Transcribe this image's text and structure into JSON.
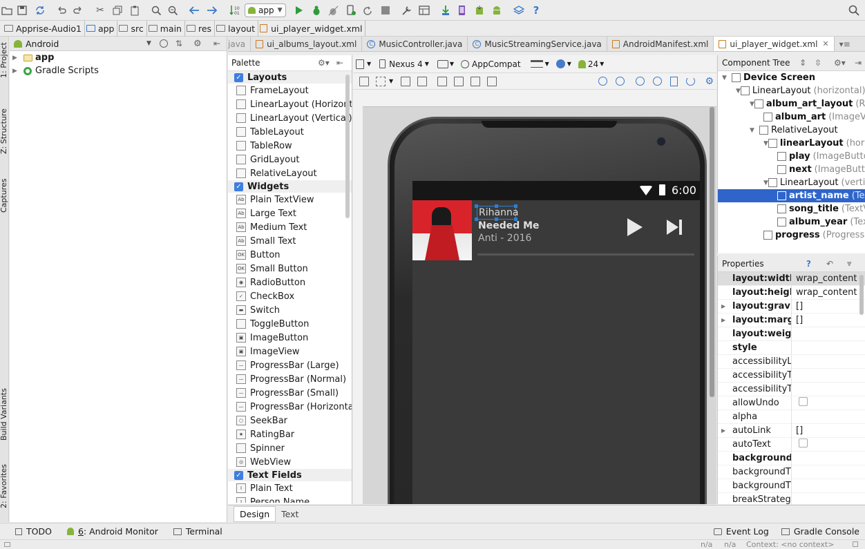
{
  "toolbar": {
    "run_config": "app",
    "icons": [
      "folder-open-icon",
      "save-icon",
      "sync-icon",
      "undo-icon",
      "redo-icon",
      "cut-icon",
      "copy-icon",
      "paste-icon",
      "find-icon",
      "replace-icon",
      "back-icon",
      "forward-icon",
      "build-icon",
      "run-config-icon",
      "run-icon",
      "debug-icon",
      "attach-debugger-icon",
      "apply-changes-icon",
      "rerun-icon",
      "stop-icon",
      "project-structure-icon",
      "sdk-manager-icon",
      "avd-manager-icon",
      "android-icon",
      "help-icon",
      "search-icon"
    ]
  },
  "breadcrumbs": [
    "Apprise-Audio1",
    "app",
    "src",
    "main",
    "res",
    "layout",
    "ui_player_widget.xml"
  ],
  "left_strip": {
    "top": [
      "1: Project",
      "Z: Structure",
      "Captures"
    ],
    "bottom": [
      "Build Variants",
      "2: Favorites"
    ]
  },
  "project": {
    "view_selector": "Android",
    "tree": [
      {
        "label": "app",
        "expanded": false
      },
      {
        "label": "Gradle Scripts",
        "expanded": false
      }
    ]
  },
  "editor_tabs": [
    {
      "label": "java",
      "active": false,
      "kind": "partial"
    },
    {
      "label": "ui_albums_layout.xml",
      "active": false,
      "kind": "xml"
    },
    {
      "label": "MusicController.java",
      "active": false,
      "kind": "class"
    },
    {
      "label": "MusicStreamingService.java",
      "active": false,
      "kind": "class"
    },
    {
      "label": "AndroidManifest.xml",
      "active": false,
      "kind": "xml"
    },
    {
      "label": "ui_player_widget.xml",
      "active": true,
      "kind": "xml"
    }
  ],
  "palette": {
    "title": "Palette",
    "items": [
      {
        "label": "Layouts",
        "group": true
      },
      {
        "label": "FrameLayout"
      },
      {
        "label": "LinearLayout (Horizontal)"
      },
      {
        "label": "LinearLayout (Vertical)"
      },
      {
        "label": "TableLayout"
      },
      {
        "label": "TableRow"
      },
      {
        "label": "GridLayout"
      },
      {
        "label": "RelativeLayout"
      },
      {
        "label": "Widgets",
        "group": true
      },
      {
        "label": "Plain TextView"
      },
      {
        "label": "Large Text"
      },
      {
        "label": "Medium Text"
      },
      {
        "label": "Small Text"
      },
      {
        "label": "Button"
      },
      {
        "label": "Small Button"
      },
      {
        "label": "RadioButton"
      },
      {
        "label": "CheckBox"
      },
      {
        "label": "Switch"
      },
      {
        "label": "ToggleButton"
      },
      {
        "label": "ImageButton"
      },
      {
        "label": "ImageView"
      },
      {
        "label": "ProgressBar (Large)"
      },
      {
        "label": "ProgressBar (Normal)"
      },
      {
        "label": "ProgressBar (Small)"
      },
      {
        "label": "ProgressBar (Horizontal)"
      },
      {
        "label": "SeekBar"
      },
      {
        "label": "RatingBar"
      },
      {
        "label": "Spinner"
      },
      {
        "label": "WebView"
      },
      {
        "label": "Text Fields",
        "group": true
      },
      {
        "label": "Plain Text"
      },
      {
        "label": "Person Name"
      }
    ]
  },
  "design_toolbar": {
    "device": "Nexus 4",
    "theme": "AppCompat",
    "api": "24"
  },
  "preview": {
    "time": "6:00",
    "artist": "Rihanna",
    "song": "Needed Me",
    "album": "Anti - 2016",
    "progress": 0.0
  },
  "component_tree": {
    "title": "Component Tree",
    "rows": [
      {
        "name": "Device Screen",
        "type": "",
        "depth": 0,
        "arrow": "down"
      },
      {
        "name": "LinearLayout",
        "type": "(horizontal)",
        "depth": 1,
        "arrow": "down",
        "plain": true
      },
      {
        "name": "album_art_layout",
        "type": "(RelativeLayout)",
        "depth": 2,
        "arrow": "down"
      },
      {
        "name": "album_art",
        "type": "(ImageView)",
        "depth": 3,
        "arrow": ""
      },
      {
        "name": "RelativeLayout",
        "type": "",
        "depth": 2,
        "arrow": "down",
        "plain": true
      },
      {
        "name": "linearLayout",
        "type": "(horizontal)",
        "depth": 3,
        "arrow": "down"
      },
      {
        "name": "play",
        "type": "(ImageButton)",
        "depth": 4,
        "arrow": ""
      },
      {
        "name": "next",
        "type": "(ImageButton)",
        "depth": 4,
        "arrow": ""
      },
      {
        "name": "LinearLayout",
        "type": "(vertical)",
        "depth": 3,
        "arrow": "down",
        "plain": true
      },
      {
        "name": "artist_name",
        "type": "(TextView)",
        "depth": 4,
        "arrow": "",
        "selected": true
      },
      {
        "name": "song_title",
        "type": "(TextView)",
        "depth": 4,
        "arrow": ""
      },
      {
        "name": "album_year",
        "type": "(TextView)",
        "depth": 4,
        "arrow": ""
      },
      {
        "name": "progress",
        "type": "(ProgressBar)",
        "depth": 3,
        "arrow": ""
      }
    ]
  },
  "properties": {
    "title": "Properties",
    "rows": [
      {
        "key": "layout:width",
        "value": "wrap_content",
        "bold": true,
        "highlight": true
      },
      {
        "key": "layout:height",
        "value": "wrap_content",
        "bold": true
      },
      {
        "key": "layout:gravity",
        "value": "[]",
        "bold": true,
        "arrow": true
      },
      {
        "key": "layout:margin",
        "value": "[]",
        "bold": true,
        "arrow": true
      },
      {
        "key": "layout:weight",
        "value": "",
        "bold": true
      },
      {
        "key": "style",
        "value": "",
        "bold": true
      },
      {
        "key": "accessibilityLiveRegion",
        "value": ""
      },
      {
        "key": "accessibilityTraversalAfter",
        "value": ""
      },
      {
        "key": "accessibilityTraversalBefore",
        "value": ""
      },
      {
        "key": "allowUndo",
        "value": "",
        "checkbox": true
      },
      {
        "key": "alpha",
        "value": ""
      },
      {
        "key": "autoLink",
        "value": "[]",
        "arrow": true
      },
      {
        "key": "autoText",
        "value": "",
        "checkbox": true
      },
      {
        "key": "background",
        "value": "",
        "bold": true
      },
      {
        "key": "backgroundTint",
        "value": ""
      },
      {
        "key": "backgroundTintMode",
        "value": ""
      },
      {
        "key": "breakStrategy",
        "value": ""
      }
    ]
  },
  "design_tabs": {
    "design": "Design",
    "text": "Text"
  },
  "tool_windows": {
    "todo": "TODO",
    "monitor_num": "6",
    "monitor": ": Android Monitor",
    "terminal": "Terminal",
    "event_log": "Event Log",
    "gradle_console": "Gradle Console"
  },
  "status_bar": {
    "pos1": "n/a",
    "pos2": "n/a",
    "context": "Context: <no context>"
  },
  "colors": {
    "accent": "#2f65ca",
    "phone_body": "#2a2a2a",
    "screen_bg": "#3a3a3a",
    "album_red": "#d9232a"
  }
}
